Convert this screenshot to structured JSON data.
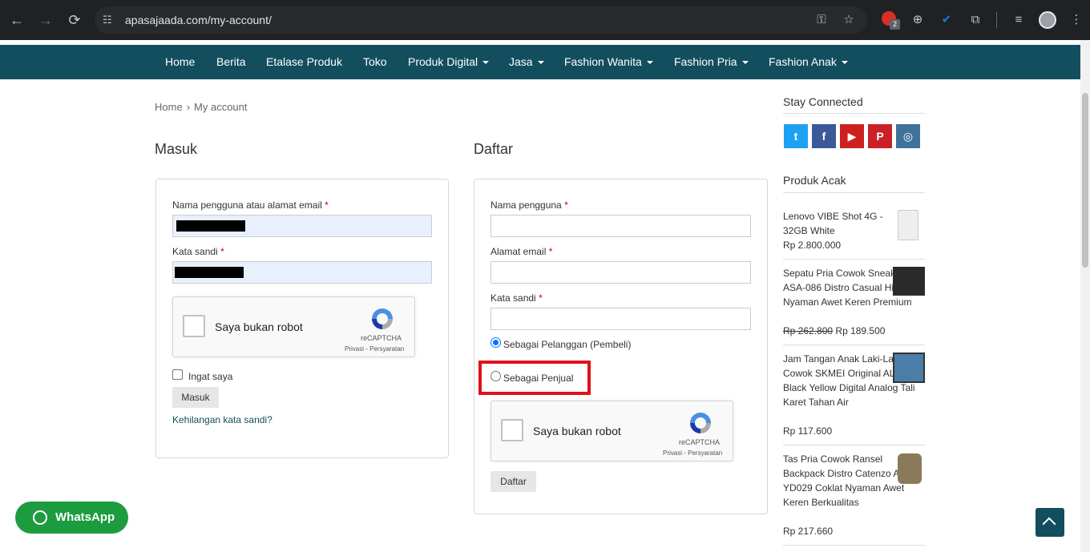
{
  "browser": {
    "url": "apasajaada.com/my-account/",
    "extension_badge_count": "2"
  },
  "nav": {
    "items": [
      {
        "label": "Home",
        "dropdown": false
      },
      {
        "label": "Berita",
        "dropdown": false
      },
      {
        "label": "Etalase Produk",
        "dropdown": false
      },
      {
        "label": "Toko",
        "dropdown": false
      },
      {
        "label": "Produk Digital",
        "dropdown": true
      },
      {
        "label": "Jasa",
        "dropdown": true
      },
      {
        "label": "Fashion Wanita",
        "dropdown": true
      },
      {
        "label": "Fashion Pria",
        "dropdown": true
      },
      {
        "label": "Fashion Anak",
        "dropdown": true
      }
    ]
  },
  "breadcrumb": {
    "home": "Home",
    "current": "My account"
  },
  "login": {
    "title": "Masuk",
    "username_label": "Nama pengguna atau alamat email",
    "password_label": "Kata sandi",
    "required_mark": "*",
    "captcha_text": "Saya bukan robot",
    "captcha_brand": "reCAPTCHA",
    "captcha_privacy": "Privasi - Persyaratan",
    "remember_label": "Ingat saya",
    "submit_label": "Masuk",
    "lost_password": "Kehilangan kata sandi?"
  },
  "register": {
    "title": "Daftar",
    "username_label": "Nama pengguna",
    "email_label": "Alamat email",
    "password_label": "Kata sandi",
    "required_mark": "*",
    "role_buyer": "Sebagai Pelanggan (Pembeli)",
    "role_seller": "Sebagai Penjual",
    "selected_role": "buyer",
    "captcha_text": "Saya bukan robot",
    "captcha_brand": "reCAPTCHA",
    "captcha_privacy": "Privasi - Persyaratan",
    "submit_label": "Daftar"
  },
  "sidebar": {
    "stay_connected": "Stay Connected",
    "social": [
      {
        "name": "twitter",
        "glyph": "t",
        "color": "#1da1f2"
      },
      {
        "name": "facebook",
        "glyph": "f",
        "color": "#3b5998"
      },
      {
        "name": "youtube",
        "glyph": "▶",
        "color": "#cd201f"
      },
      {
        "name": "pinterest",
        "glyph": "P",
        "color": "#cb2027"
      },
      {
        "name": "instagram",
        "glyph": "◎",
        "color": "#3f729b"
      }
    ],
    "random_products_title": "Produk Acak",
    "products": [
      {
        "name": "Lenovo VIBE Shot 4G - 32GB White",
        "price": "Rp 2.800.000",
        "old_price": ""
      },
      {
        "name": "Sepatu Pria Cowok Sneakers ASA-086 Distro Casual Hitam Nyaman Awet Keren Premium",
        "price": "Rp 189.500",
        "old_price": "Rp 262.800"
      },
      {
        "name": "Jam Tangan Anak Laki-Laki Cowok SKMEI Original AL0001 Black Yellow Digital Analog Tali Karet Tahan Air",
        "price": "Rp 117.600",
        "old_price": ""
      },
      {
        "name": "Tas Pria Cowok Ransel Backpack Distro Catenzo ASA-YD029 Coklat Nyaman Awet Keren Berkualitas",
        "price": "Rp 217.660",
        "old_price": ""
      }
    ]
  },
  "whatsapp": {
    "label": "WhatsApp"
  },
  "colors": {
    "primary": "#134e5e",
    "highlight": "#e0111b",
    "whatsapp": "#1d9b3f"
  }
}
